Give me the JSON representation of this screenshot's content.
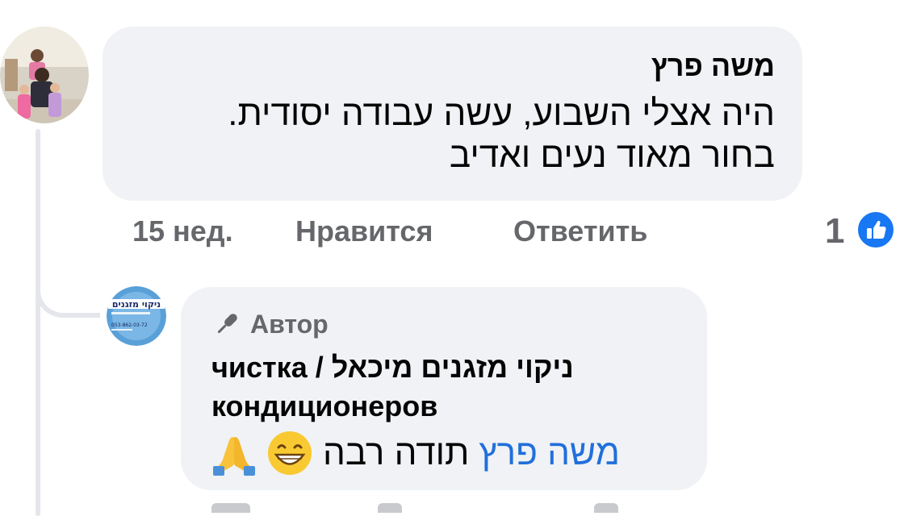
{
  "comment": {
    "author": "משה פרץ",
    "text_line1": "היה אצלי השבוע, עשה עבודה יסודית.",
    "text_line2": "בחור מאוד נעים ואדיב",
    "time": "15 нед.",
    "like_label": "Нравится",
    "reply_label": "Ответить",
    "reaction_count": "1",
    "reaction_icon": "thumbs-up-icon",
    "reaction_color": "#1877f2"
  },
  "reply": {
    "author_tag": "Автор",
    "author_tag_icon": "microphone-icon",
    "author_name_rtl": "ניקוי מזגנים מיכאל",
    "author_name_sep": " / ",
    "author_name_ru1": "чистка",
    "author_name_ru2": "кондиционеров",
    "mention": "משה פרץ",
    "text": "תודה רבה",
    "emoji": [
      "grinning-face-icon",
      "folded-hands-icon"
    ],
    "avatar_text": "ניקוי מזגנים",
    "avatar_phone": "053-862-03-72",
    "mention_color": "#216fdb"
  }
}
